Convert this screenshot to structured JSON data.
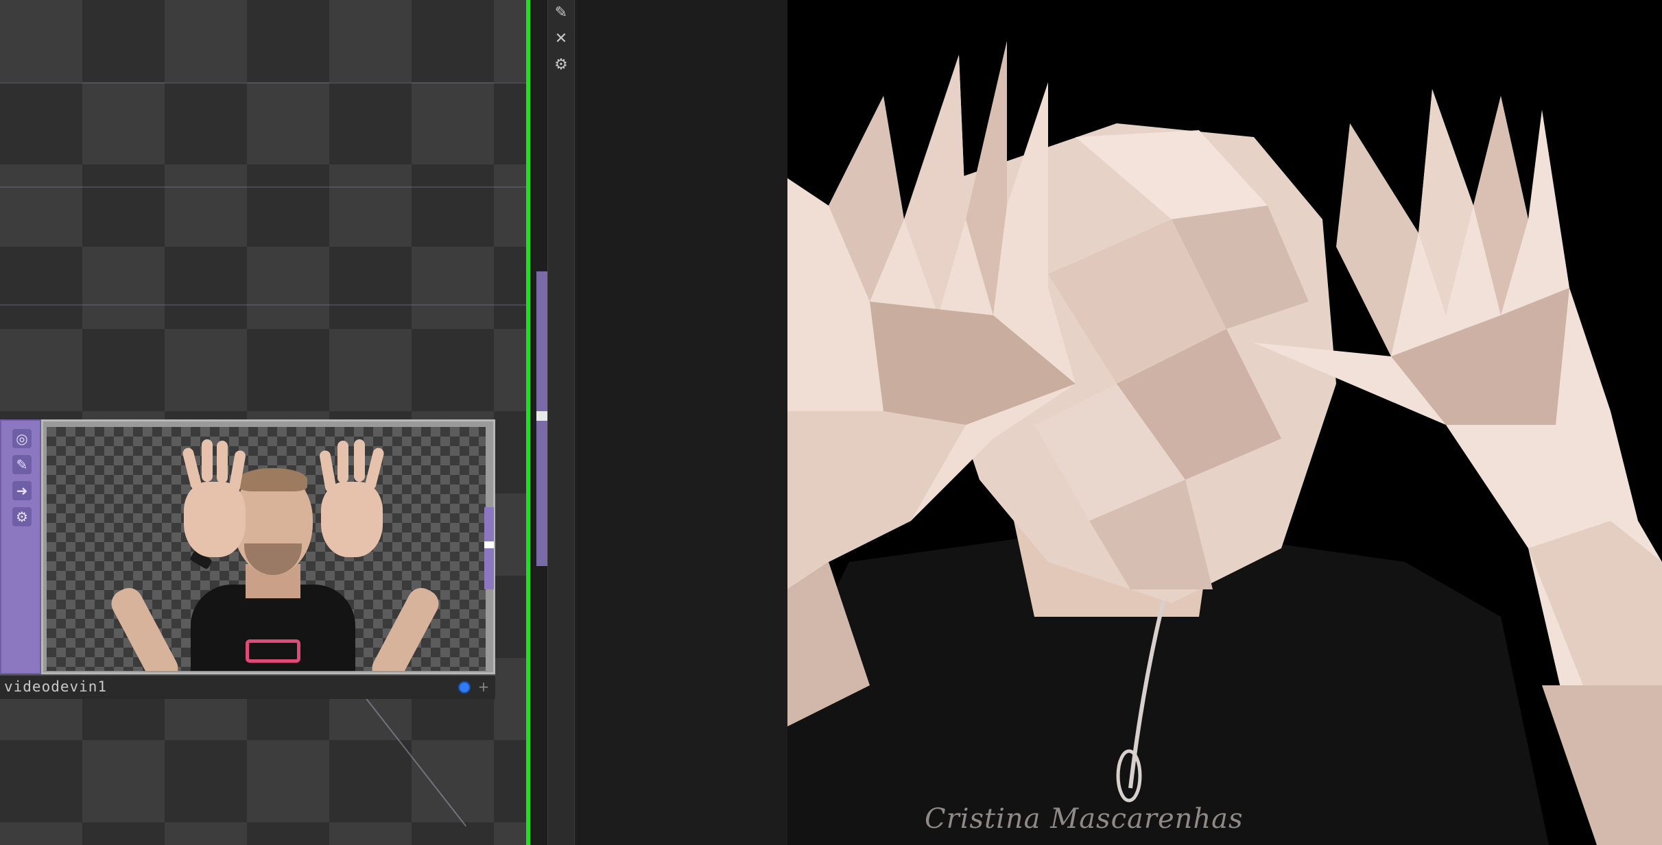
{
  "network": {
    "node": {
      "name": "videodevin1",
      "sidebar_icons": [
        "viewer-toggle-icon",
        "pin-icon",
        "arrow-right-icon",
        "bypass-icon"
      ]
    }
  },
  "toolbar_strip": {
    "icons": [
      "pin-icon",
      "close-icon",
      "settings-icon"
    ]
  },
  "viewer": {
    "watermark": "Cristina Mascarenhas"
  },
  "colors": {
    "operator_purple": "#8b78c0",
    "active_green": "#1ee01e",
    "flag_blue": "#2f7cf6"
  }
}
